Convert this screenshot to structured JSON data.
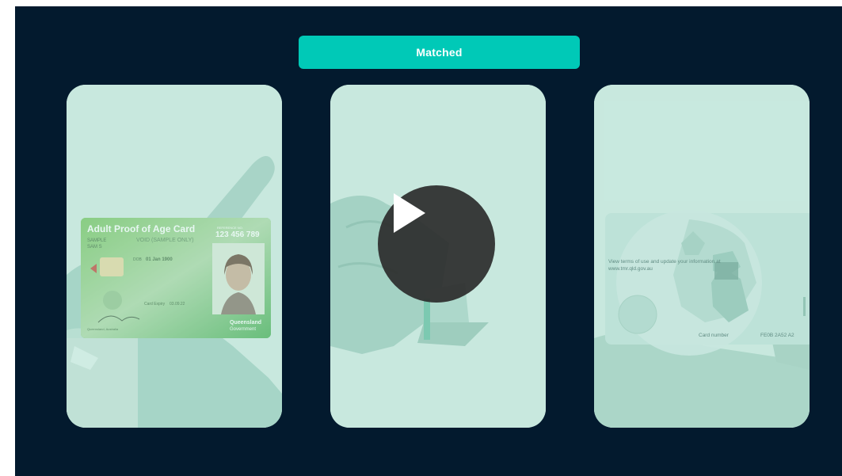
{
  "status": {
    "label": "Matched",
    "color": "#00c9b7"
  },
  "front_card": {
    "title": "Adult Proof of Age Card",
    "reference_label": "REFERENCE NO.",
    "reference_number": "123 456 789",
    "surname": "SAMPLE",
    "given_name": "SAM S",
    "void_text": "VOID (SAMPLE ONLY)",
    "dob_label": "DOB",
    "dob_value": "01 Jan 1900",
    "expiry_label": "Card Expiry",
    "expiry_value": "03.09.22",
    "signature_caption": "Queensland, Australia",
    "issuer_line1": "Queensland",
    "issuer_line2": "Government"
  },
  "middle_panel": {
    "play_icon": "play-icon"
  },
  "back_card": {
    "terms_line1": "View terms of use and update your information at",
    "terms_line2": "www.tmr.qld.gov.au",
    "card_number_label": "Card number",
    "card_number_value": "FE0B 2A52 A2"
  }
}
